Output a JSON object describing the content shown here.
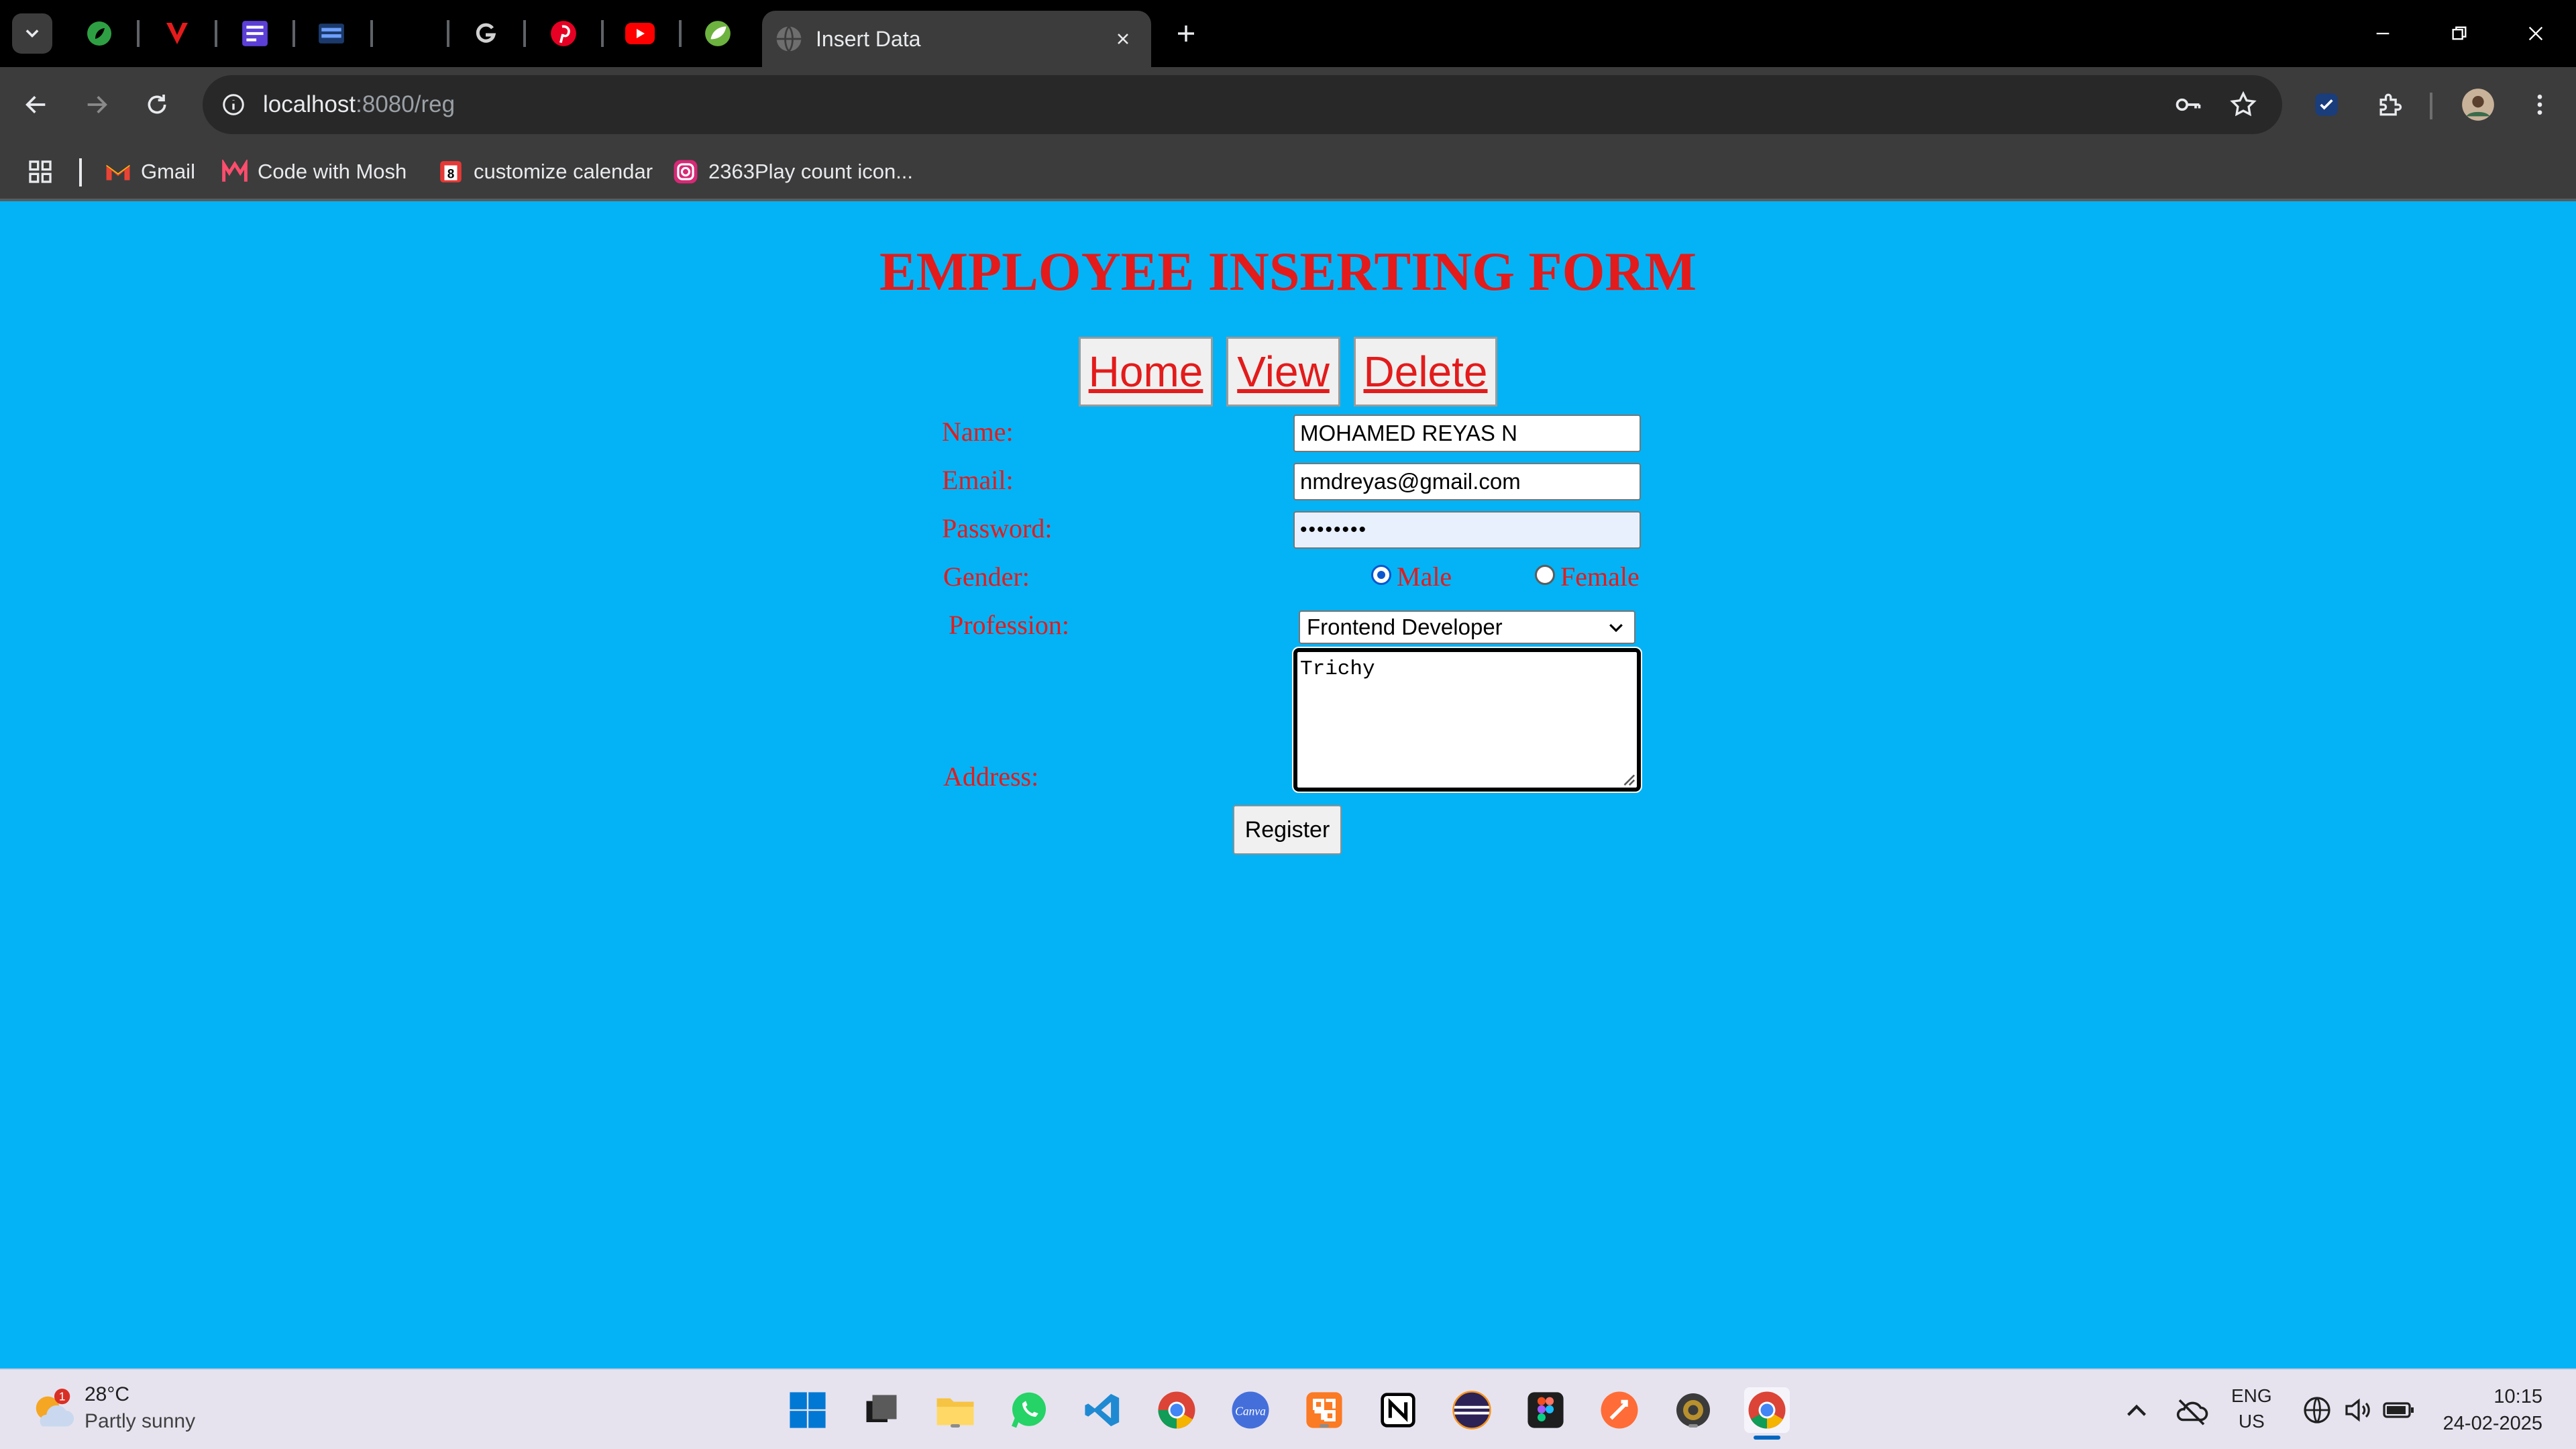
{
  "browser": {
    "active_tab_title": "Insert Data",
    "url_host": "localhost",
    "url_path": ":8080/reg",
    "bookmarks": [
      {
        "label": "Gmail",
        "icon": "gmail-icon"
      },
      {
        "label": "Code with Mosh",
        "icon": "code-with-mosh-icon"
      },
      {
        "label": "customize calendar",
        "icon": "calendar-icon"
      },
      {
        "label": "2363Play count icon...",
        "icon": "instagram-icon"
      }
    ],
    "pinned_tabs": [
      "grammarly-like-icon",
      "v-icon",
      "editor-icon",
      "screen-icon",
      "blank-icon",
      "g-icon",
      "pinterest-icon",
      "youtube-icon",
      "spring-icon"
    ]
  },
  "form": {
    "title": "EMPLOYEE INSERTING FORM",
    "nav": {
      "home": "Home",
      "view": "View",
      "delete": "Delete"
    },
    "labels": {
      "name": "Name:",
      "email": "Email:",
      "password": "Password:",
      "gender": "Gender:",
      "profession": "Profession:",
      "address": "Address:"
    },
    "values": {
      "name": "MOHAMED REYAS N",
      "email": "nmdreyas@gmail.com",
      "password_mask": "••••••••",
      "profession": "Frontend Developer",
      "address": "Trichy"
    },
    "gender_options": {
      "male": "Male",
      "female": "Female",
      "selected": "Male"
    },
    "register_label": "Register"
  },
  "taskbar": {
    "weather_temp": "28°C",
    "weather_desc": "Partly sunny",
    "weather_badge": "1",
    "lang_1": "ENG",
    "lang_2": "US",
    "time": "10:15",
    "date": "24-02-2025"
  },
  "colors": {
    "page_bg": "#03b3f5",
    "form_text": "#e31b1b",
    "chrome_dark": "#3c3c3c"
  }
}
